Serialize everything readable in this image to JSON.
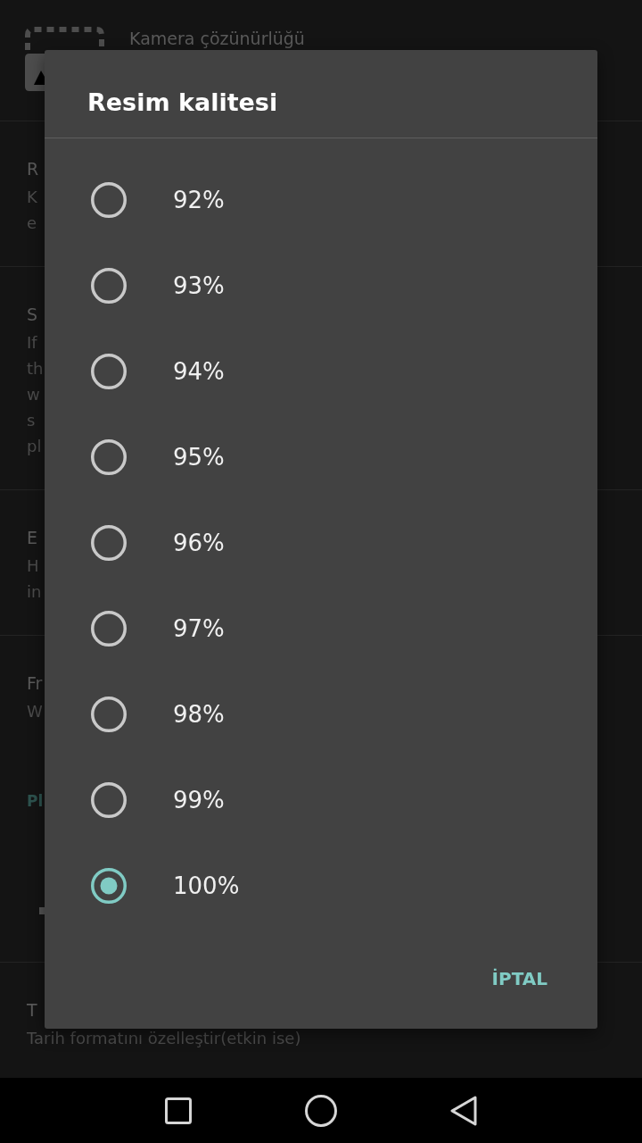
{
  "background": {
    "items": [
      {
        "kind": "icon_setting",
        "title": "Kamera çözünürlüğü"
      },
      {
        "kind": "setting",
        "title": "R",
        "summary": [
          "K",
          "e"
        ]
      },
      {
        "kind": "setting",
        "title": "S",
        "summary": [
          "If",
          "th",
          "w",
          "s",
          "pl"
        ]
      },
      {
        "kind": "setting",
        "title": "E",
        "summary": [
          "H",
          "in"
        ]
      },
      {
        "kind": "setting",
        "title": "Fr",
        "summary": [
          "W"
        ]
      },
      {
        "kind": "section",
        "title": "Pl"
      },
      {
        "kind": "icon_only"
      },
      {
        "kind": "setting",
        "title": "T",
        "summary": [
          "Tarih formatını özelleştir(etkin ise)"
        ]
      }
    ]
  },
  "dialog": {
    "title": "Resim kalitesi",
    "options": [
      {
        "label": "92%",
        "selected": false
      },
      {
        "label": "93%",
        "selected": false
      },
      {
        "label": "94%",
        "selected": false
      },
      {
        "label": "95%",
        "selected": false
      },
      {
        "label": "96%",
        "selected": false
      },
      {
        "label": "97%",
        "selected": false
      },
      {
        "label": "98%",
        "selected": false
      },
      {
        "label": "99%",
        "selected": false
      },
      {
        "label": "100%",
        "selected": true
      }
    ],
    "buttons": [
      "İPTAL"
    ]
  },
  "nav_bar": {
    "buttons": [
      {
        "kind": "recents"
      },
      {
        "kind": "home"
      },
      {
        "kind": "back"
      }
    ]
  }
}
